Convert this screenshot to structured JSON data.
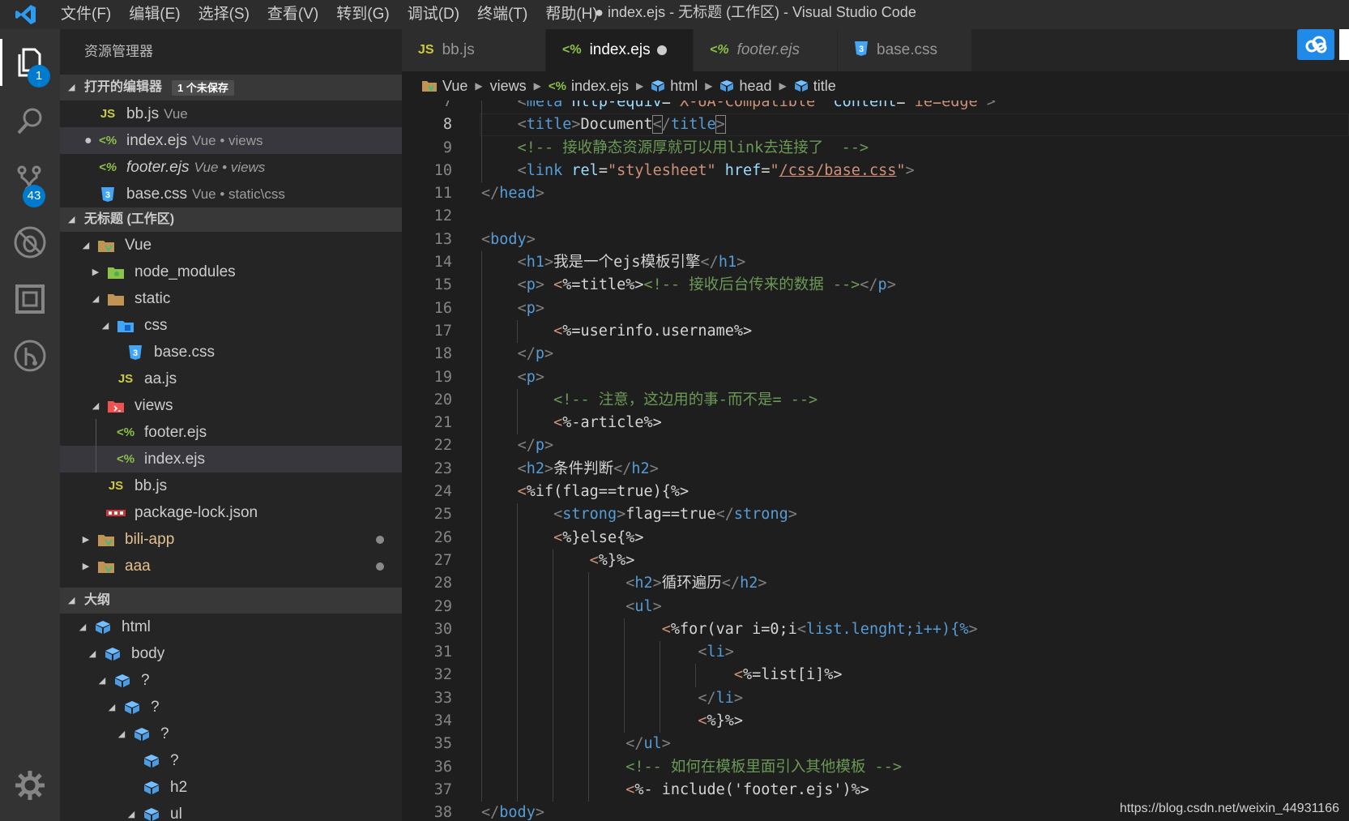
{
  "titlebar": {
    "menu": [
      "文件(F)",
      "编辑(E)",
      "选择(S)",
      "查看(V)",
      "转到(G)",
      "调试(D)",
      "终端(T)",
      "帮助(H)"
    ],
    "title": "● index.ejs - 无标题 (工作区) - Visual Studio Code"
  },
  "activity": {
    "explorer_badge": "1",
    "scm_badge": "43"
  },
  "sidebar": {
    "title": "资源管理器",
    "open_editors": {
      "header": "打开的编辑器",
      "badge": "1 个未保存",
      "items": [
        {
          "icon": "JS",
          "name": "bb.js",
          "desc": "Vue"
        },
        {
          "icon": "<%",
          "name": "index.ejs",
          "desc": "Vue • views"
        },
        {
          "icon": "<%",
          "name": "footer.ejs",
          "desc": "Vue • views"
        },
        {
          "icon": "3",
          "name": "base.css",
          "desc": "Vue • static\\css"
        }
      ]
    },
    "workspace": {
      "header": "无标题 (工作区)",
      "items": [
        "Vue",
        "node_modules",
        "static",
        "css",
        "base.css",
        "aa.js",
        "views",
        "footer.ejs",
        "index.ejs",
        "bb.js",
        "package-lock.json",
        "bili-app",
        "aaa"
      ]
    },
    "outline": {
      "header": "大纲",
      "items": [
        "html",
        "body",
        "?",
        "?",
        "?",
        "?",
        "h2",
        "ul"
      ]
    }
  },
  "tabs": [
    {
      "icon": "JS",
      "label": "bb.js"
    },
    {
      "icon": "<%",
      "label": "index.ejs"
    },
    {
      "icon": "<%",
      "label": "footer.ejs"
    },
    {
      "icon": "3",
      "label": "base.css"
    }
  ],
  "breadcrumb": [
    "Vue",
    "views",
    "index.ejs",
    "html",
    "head",
    "title"
  ],
  "watermark": "https://blog.csdn.net/weixin_44931166"
}
